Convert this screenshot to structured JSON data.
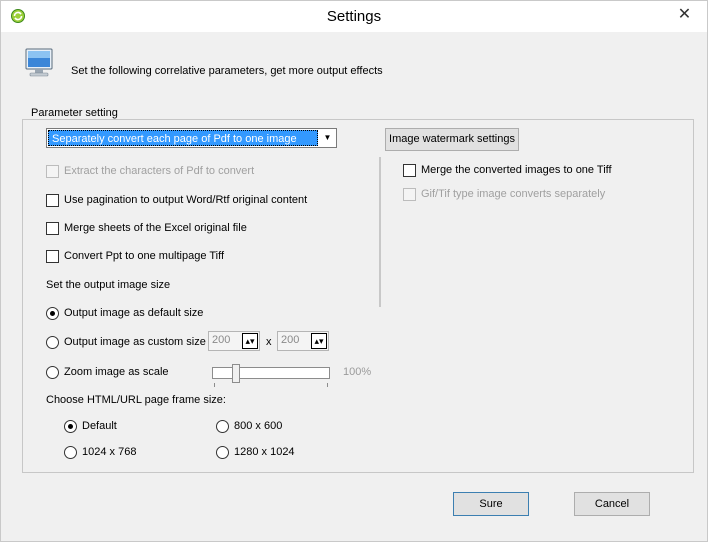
{
  "window": {
    "title": "Settings",
    "close_glyph": "✕",
    "description": "Set the following correlative parameters, get more output effects"
  },
  "group": {
    "label": "Parameter setting",
    "mode_select": {
      "value": "Separately convert each page of Pdf to one image",
      "arrow": "▼"
    },
    "watermark_button": "Image watermark settings",
    "options": {
      "extract_chars": "Extract the characters of Pdf to convert",
      "pagination": "Use pagination to output Word/Rtf original content",
      "merge_sheets": "Merge sheets of the Excel original file",
      "ppt_multipage": "Convert Ppt to one multipage Tiff"
    },
    "right_options": {
      "merge_tiff": "Merge the converted images to one Tiff",
      "gif_tif": "Gif/Tif type image converts separately"
    },
    "image_size": {
      "heading": "Set the output image size",
      "default_label": "Output image as default size",
      "custom_label": "Output image as custom size",
      "width_value": "200",
      "times": "x",
      "height_value": "200",
      "zoom_label": "Zoom image as scale",
      "zoom_value": "100%",
      "zoom_fraction": 0.2
    },
    "frame": {
      "heading": "Choose HTML/URL page frame size:",
      "opt_default": "Default",
      "opt_800": "800 x 600",
      "opt_1024": "1024 x 768",
      "opt_1280": "1280 x 1024"
    }
  },
  "buttons": {
    "sure": "Sure",
    "cancel": "Cancel"
  },
  "colors": {
    "selection": "#3399ff",
    "window_bg": "#f0f0f0"
  }
}
